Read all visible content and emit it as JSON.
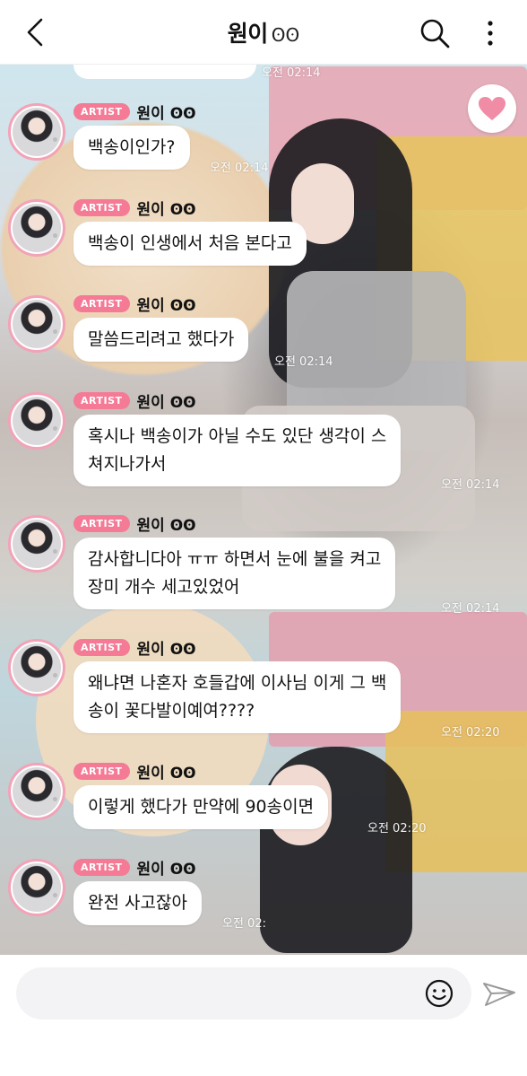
{
  "header": {
    "title": "원이",
    "title_glyph": "ʘʘ"
  },
  "background": {
    "timestamps": [
      "오전 02:14",
      "오전 02:14",
      "오전 02:14",
      "오전 02:14",
      "오전 02:14",
      "오전 02:20",
      "오전 02:20",
      "오전 02:"
    ]
  },
  "badge_label": "ARTIST",
  "sender": "원이 ʘʘ",
  "messages": [
    {
      "text": "백송이인가?"
    },
    {
      "text": "백송이 인생에서 처음 본다고"
    },
    {
      "text": "말씀드리려고 했다가"
    },
    {
      "text": "혹시나 백송이가 아닐 수도 있단 생각이 스\n쳐지나가서"
    },
    {
      "text": "감사합니다아 ㅠㅠ 하면서 눈에 불을 켜고\n장미 개수 세고있었어"
    },
    {
      "text": "왜냐면 나혼자 호들갑에 이사님 이게 그 백\n송이 꽃다발이예여????"
    },
    {
      "text": "이렇게 했다가 만약에 90송이면"
    },
    {
      "text": "완전 사고잖아"
    }
  ],
  "input": {
    "placeholder": ""
  },
  "colors": {
    "badge": "#f57a95",
    "avatar_ring": "#f2a3b8",
    "like_heart": "#f08ca6"
  },
  "icons": [
    "chevron-left-icon",
    "search-icon",
    "more-vertical-icon",
    "heart-icon",
    "emoji-icon",
    "send-icon"
  ]
}
